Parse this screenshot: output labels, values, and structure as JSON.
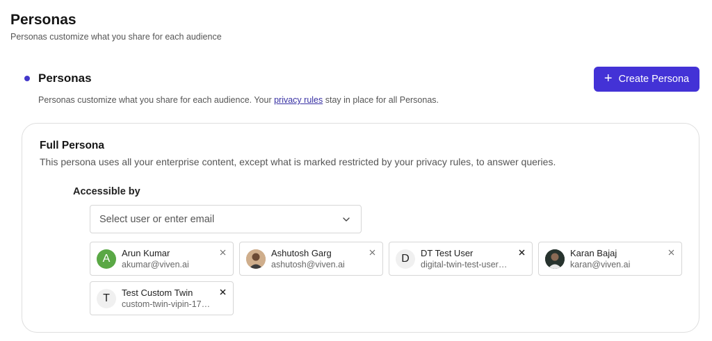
{
  "header": {
    "title": "Personas",
    "subtitle": "Personas customize what you share for each audience"
  },
  "section": {
    "title": "Personas",
    "desc_before": "Personas customize what you share for each audience. Your ",
    "desc_link": "privacy rules",
    "desc_after": " stay in place for all Personas.",
    "create_button": "Create Persona",
    "accent_color": "#4332d6"
  },
  "persona": {
    "title": "Full Persona",
    "description": "This persona uses all your enterprise content, except what is marked restricted by your privacy rules, to answer queries.",
    "accessible_label": "Accessible by",
    "select_placeholder": "Select user or enter email",
    "users": [
      {
        "initial": "A",
        "name": "Arun Kumar",
        "email": "akumar@viven.ai",
        "avatar": "letter-green"
      },
      {
        "initial": "",
        "name": "Ashutosh Garg",
        "email": "ashutosh@viven.ai",
        "avatar": "photo"
      },
      {
        "initial": "D",
        "name": "DT Test User",
        "email": "digital-twin-test-user…",
        "avatar": "letter-gray"
      },
      {
        "initial": "",
        "name": "Karan Bajaj",
        "email": "karan@viven.ai",
        "avatar": "photo"
      },
      {
        "initial": "T",
        "name": "Test Custom Twin",
        "email": "custom-twin-vipin-17…",
        "avatar": "letter-gray"
      }
    ]
  }
}
